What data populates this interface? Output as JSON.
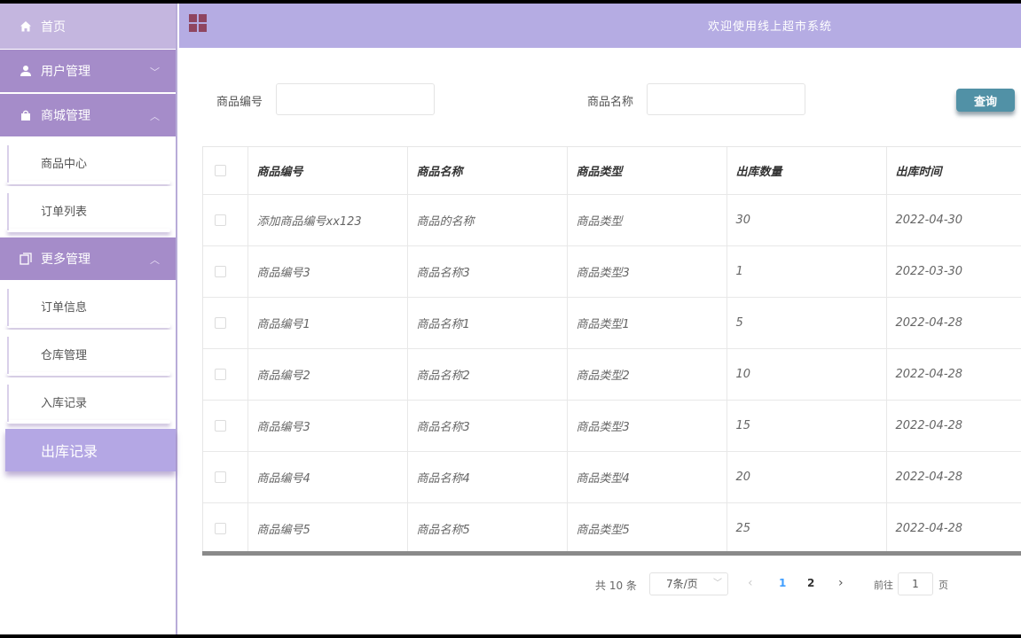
{
  "header": {
    "title": "欢迎使用线上超市系统"
  },
  "sidebar": {
    "home": "首页",
    "groups": [
      {
        "label": "用户管理",
        "expanded": false,
        "items": []
      },
      {
        "label": "商城管理",
        "expanded": true,
        "items": [
          "商品中心",
          "订单列表"
        ]
      },
      {
        "label": "更多管理",
        "expanded": true,
        "items": [
          "订单信息",
          "仓库管理",
          "入库记录",
          "出库记录"
        ]
      }
    ],
    "active_item": "出库记录"
  },
  "search": {
    "code_label": "商品编号",
    "code_value": "",
    "name_label": "商品名称",
    "name_value": "",
    "query_button": "查询"
  },
  "table": {
    "columns": [
      "商品编号",
      "商品名称",
      "商品类型",
      "出库数量",
      "出库时间"
    ],
    "rows": [
      [
        "添加商品编号xx123",
        "商品的名称",
        "商品类型",
        "30",
        "2022-04-30"
      ],
      [
        "商品编号3",
        "商品名称3",
        "商品类型3",
        "1",
        "2022-03-30"
      ],
      [
        "商品编号1",
        "商品名称1",
        "商品类型1",
        "5",
        "2022-04-28"
      ],
      [
        "商品编号2",
        "商品名称2",
        "商品类型2",
        "10",
        "2022-04-28"
      ],
      [
        "商品编号3",
        "商品名称3",
        "商品类型3",
        "15",
        "2022-04-28"
      ],
      [
        "商品编号4",
        "商品名称4",
        "商品类型4",
        "20",
        "2022-04-28"
      ],
      [
        "商品编号5",
        "商品名称5",
        "商品类型5",
        "25",
        "2022-04-28"
      ]
    ]
  },
  "pagination": {
    "total": "共 10 条",
    "page_size": "7条/页",
    "prev": "‹",
    "pages": [
      "1",
      "2"
    ],
    "current_page": "1",
    "next": "›",
    "goto_label": "前往",
    "goto_value": "1",
    "page_suffix": "页"
  },
  "colors": {
    "header_bg": "#b5ace3",
    "sidebar_group_bg": "#a58cc9",
    "active_item_bg": "#b4a7e4",
    "query_button_bg": "#5191a6",
    "grid_icon": "#8f4560"
  },
  "icons": {
    "home": "home-icon",
    "user_group": "user-icon",
    "mall_group": "shopping-bag-icon",
    "more_group": "copy-icon",
    "header": "grid-icon"
  }
}
